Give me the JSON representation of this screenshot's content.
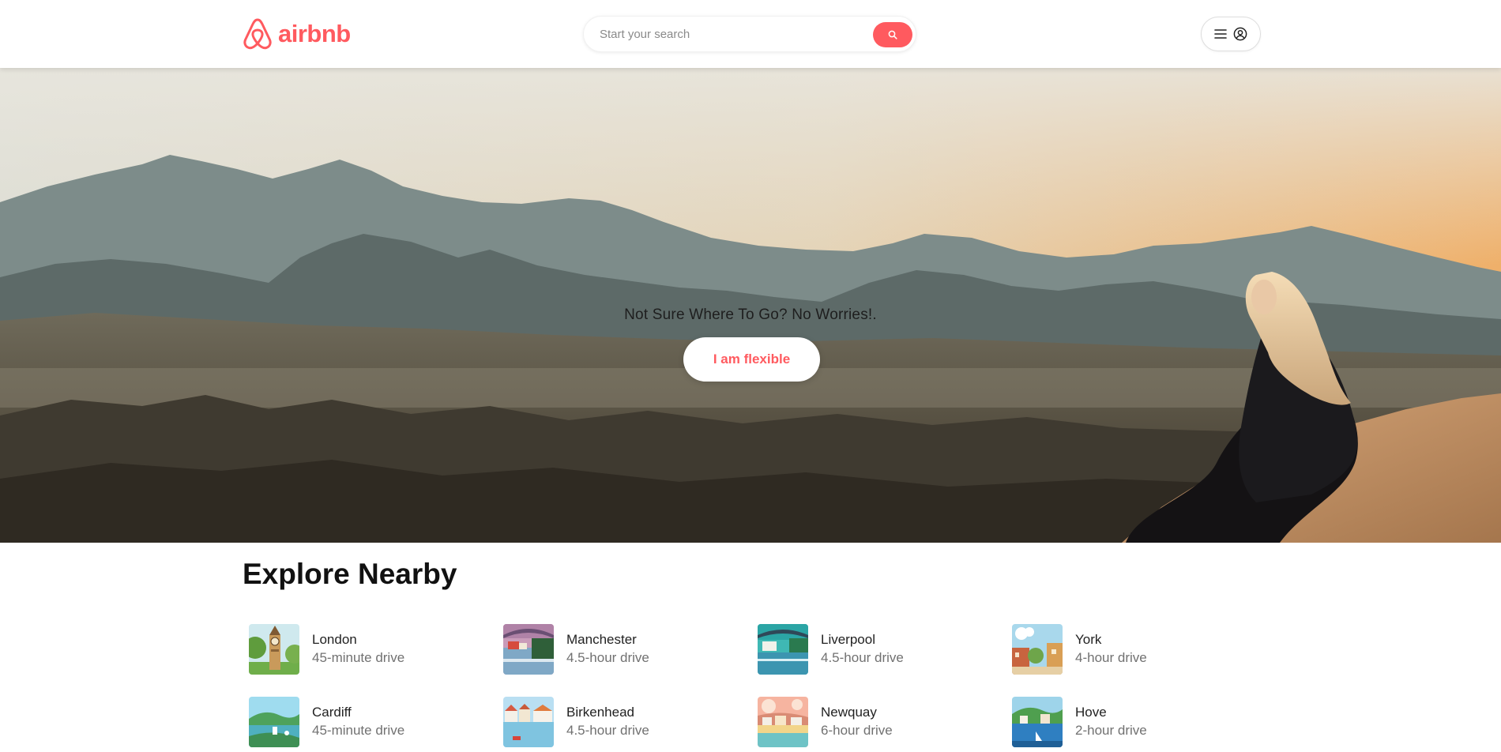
{
  "brand": {
    "name": "airbnb",
    "color": "#ff5a5f"
  },
  "search": {
    "placeholder": "Start your search",
    "icon": "search-icon"
  },
  "user_menu": {
    "icons": [
      "menu-icon",
      "user-circle-icon"
    ]
  },
  "hero": {
    "tagline": "Not Sure Where To Go? No Worries!.",
    "button_label": "I am flexible"
  },
  "explore": {
    "title": "Explore Nearby",
    "items": [
      {
        "city": "London",
        "drive": "45-minute drive"
      },
      {
        "city": "Manchester",
        "drive": "4.5-hour drive"
      },
      {
        "city": "Liverpool",
        "drive": "4.5-hour drive"
      },
      {
        "city": "York",
        "drive": "4-hour drive"
      },
      {
        "city": "Cardiff",
        "drive": "45-minute drive"
      },
      {
        "city": "Birkenhead",
        "drive": "4.5-hour drive"
      },
      {
        "city": "Newquay",
        "drive": "6-hour drive"
      },
      {
        "city": "Hove",
        "drive": "2-hour drive"
      }
    ]
  }
}
